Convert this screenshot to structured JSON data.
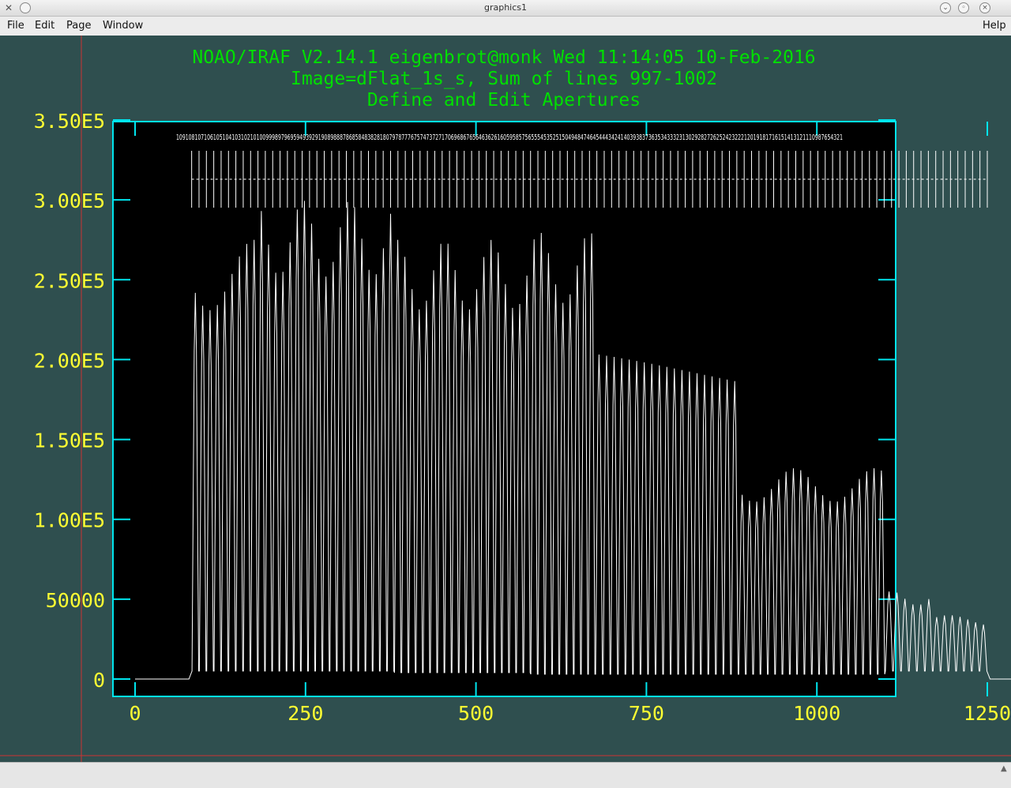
{
  "window": {
    "title": "graphics1"
  },
  "menu": {
    "file": "File",
    "edit": "Edit",
    "page": "Page",
    "window": "Window",
    "help": "Help"
  },
  "colors": {
    "background": "#2f4f4f",
    "frame": "#00e5ee",
    "header_text": "#00e000",
    "axis_labels": "#ffff33",
    "spectrum": "#ffffff",
    "cursor": "#cc3333"
  },
  "header": {
    "line1": "NOAO/IRAF V2.14.1 eigenbrot@monk Wed 11:14:05 10-Feb-2016",
    "line2": "Image=dFlat_1s_s, Sum of lines 997-1002",
    "line3": "Define and Edit Apertures"
  },
  "chart_data": {
    "type": "line",
    "title": "Define and Edit Apertures",
    "xlabel": "",
    "ylabel": "",
    "xlim": [
      -40,
      1340
    ],
    "ylim": [
      -12000,
      350000
    ],
    "x_ticks": [
      0,
      250,
      500,
      750,
      1000,
      1250
    ],
    "x_tick_labels": [
      "0",
      "250",
      "500",
      "750",
      "1000",
      "1250"
    ],
    "y_ticks": [
      0,
      50000,
      100000,
      150000,
      200000,
      250000,
      300000,
      350000
    ],
    "y_tick_labels": [
      "0",
      "50000",
      "1.00E5",
      "1.50E5",
      "2.00E5",
      "2.50E5",
      "3.00E5",
      "3.50E5"
    ],
    "aperture_count": 109,
    "aperture_x_range": [
      83,
      1250
    ],
    "aperture_label_first": "109",
    "aperture_label_last": "1",
    "aperture_labels_run": "109108107106105104103102101009998979695949392919089888786858483828180797877767574737271706968676564636261605958575655545352515049484746454443424140393837363534333231302928272625242322212019181716151413121110987654321",
    "segments": [
      {
        "x_start": 83,
        "x_end": 180,
        "peak": 275000,
        "base": 5000
      },
      {
        "x_start": 180,
        "x_end": 380,
        "peak": 300000,
        "base": 5000
      },
      {
        "x_start": 380,
        "x_end": 580,
        "peak": 275000,
        "base": 4000
      },
      {
        "x_start": 580,
        "x_end": 675,
        "peak": 280000,
        "base": 3000
      },
      {
        "x_start": 675,
        "x_end": 885,
        "peak": 208000,
        "base": 3000
      },
      {
        "x_start": 885,
        "x_end": 1100,
        "peak": 132000,
        "base": 3000
      },
      {
        "x_start": 1100,
        "x_end": 1170,
        "peak": 55000,
        "base": 5000
      },
      {
        "x_start": 1170,
        "x_end": 1250,
        "peak": 40000,
        "base": 5000
      }
    ],
    "flat_level_outside": 0,
    "grid": false
  }
}
